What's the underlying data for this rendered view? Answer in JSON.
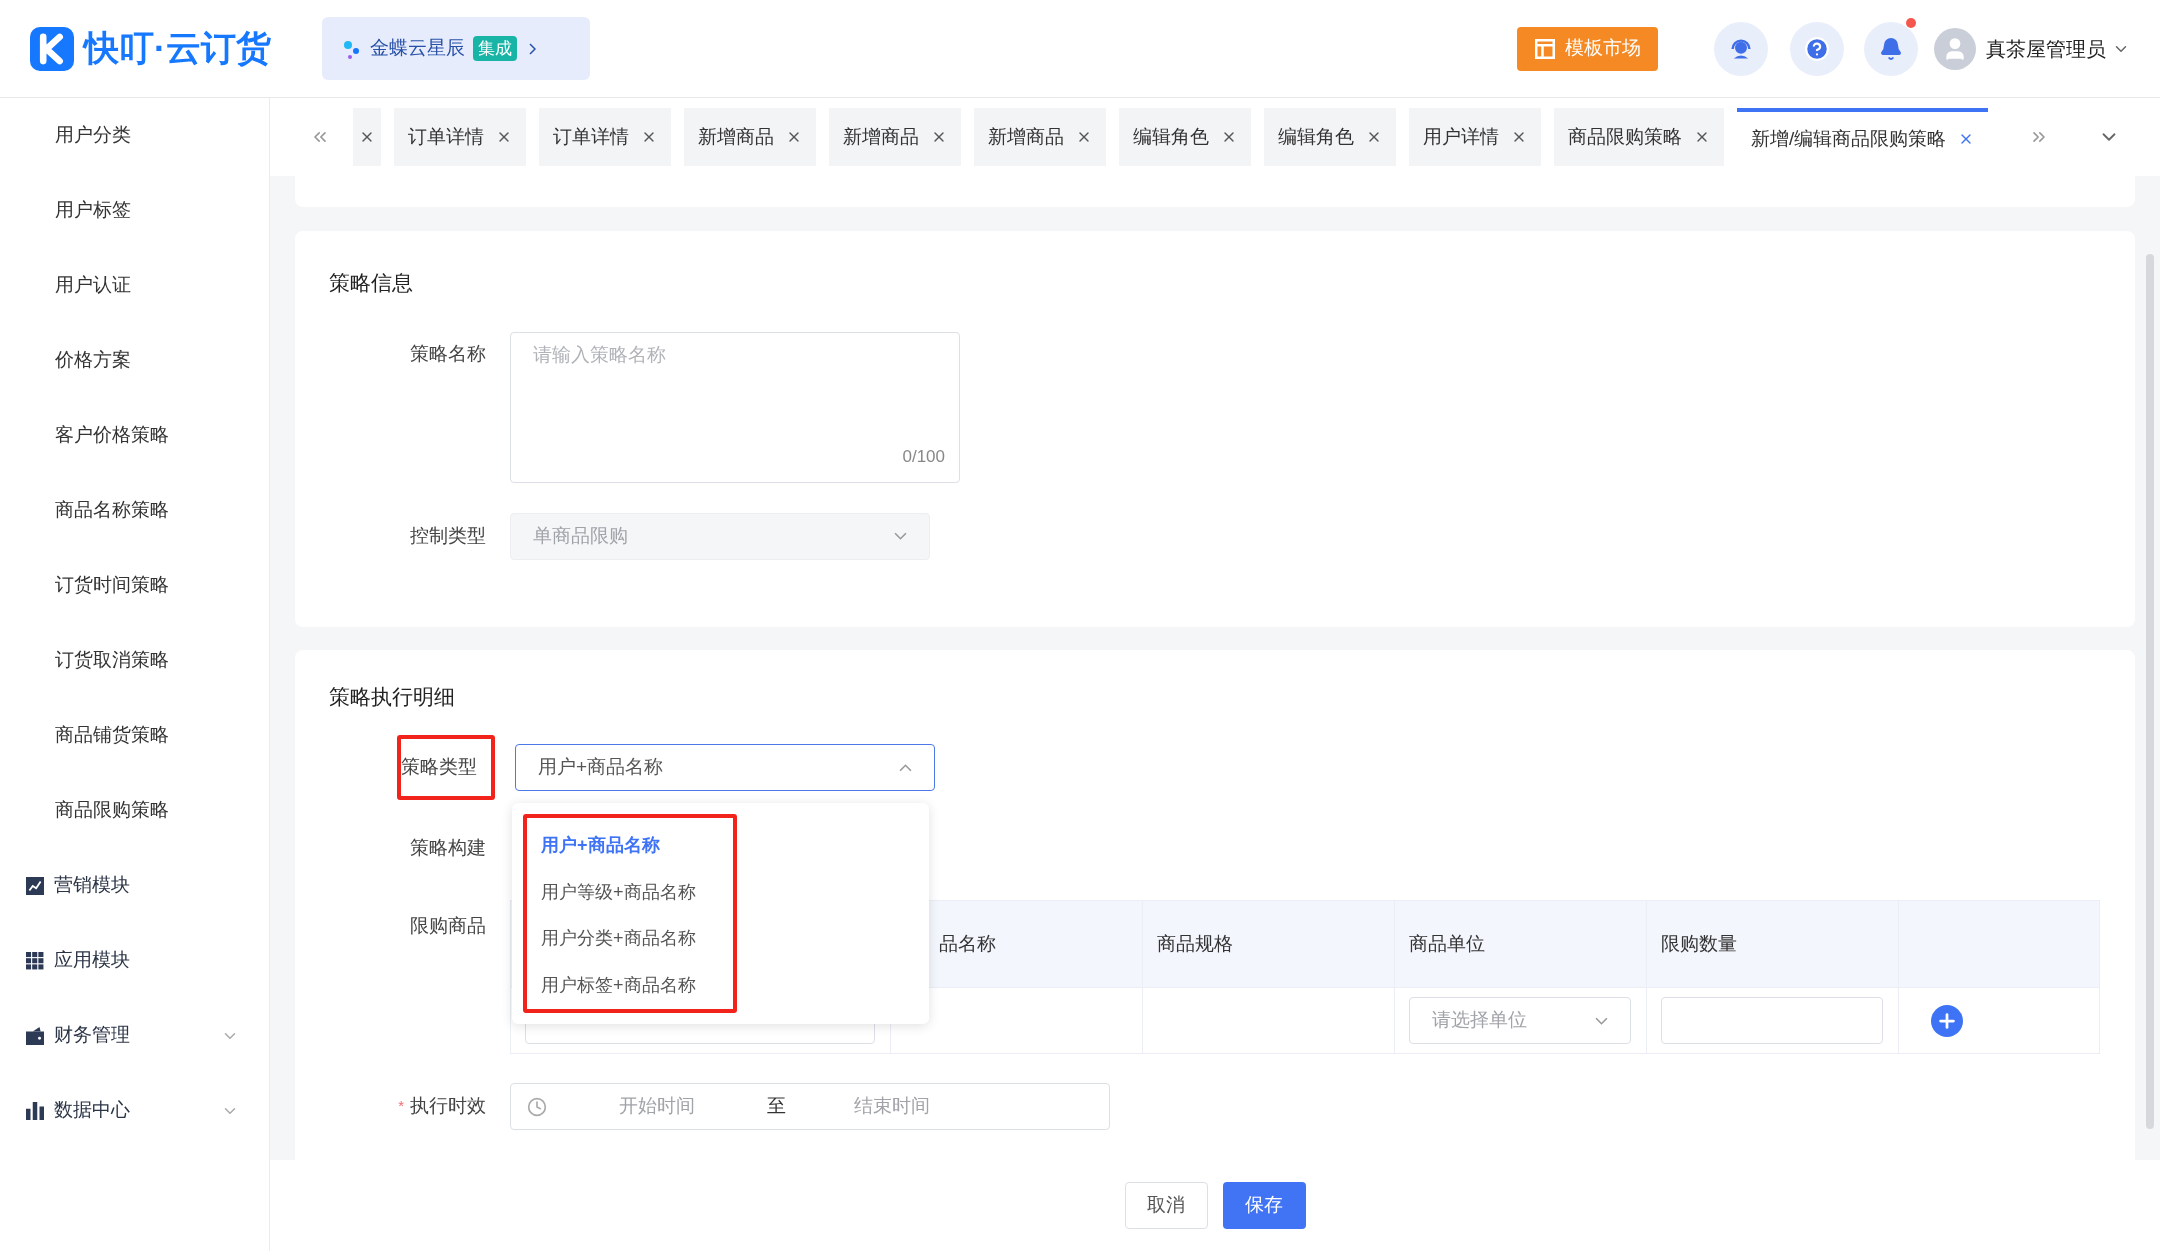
{
  "header": {
    "logo_text": "快叮·云订货",
    "banner": {
      "text": "金蝶云星辰",
      "badge": "集成"
    },
    "template_button": "模板市场",
    "notification_dot": true,
    "user_name": "真茶屋管理员"
  },
  "sidebar": {
    "items": [
      {
        "kind": "sub",
        "label": "用户分类"
      },
      {
        "kind": "sub",
        "label": "用户标签"
      },
      {
        "kind": "sub",
        "label": "用户认证"
      },
      {
        "kind": "sub",
        "label": "价格方案"
      },
      {
        "kind": "sub",
        "label": "客户价格策略"
      },
      {
        "kind": "sub",
        "label": "商品名称策略"
      },
      {
        "kind": "sub",
        "label": "订货时间策略"
      },
      {
        "kind": "sub",
        "label": "订货取消策略"
      },
      {
        "kind": "sub",
        "label": "商品铺货策略"
      },
      {
        "kind": "sub",
        "label": "商品限购策略"
      },
      {
        "kind": "module",
        "label": "营销模块"
      },
      {
        "kind": "module",
        "label": "应用模块"
      },
      {
        "kind": "group",
        "label": "财务管理",
        "expanded": false
      },
      {
        "kind": "group",
        "label": "数据中心",
        "expanded": false
      }
    ]
  },
  "tabs": [
    {
      "kind": "partial",
      "selected": false
    },
    {
      "kind": "tab",
      "label": "订单详情",
      "selected": false
    },
    {
      "kind": "tab",
      "label": "订单详情",
      "selected": false
    },
    {
      "kind": "tab",
      "label": "新增商品",
      "selected": false
    },
    {
      "kind": "tab",
      "label": "新增商品",
      "selected": false
    },
    {
      "kind": "tab",
      "label": "新增商品",
      "selected": false
    },
    {
      "kind": "tab",
      "label": "编辑角色",
      "selected": false
    },
    {
      "kind": "tab",
      "label": "编辑角色",
      "selected": false
    },
    {
      "kind": "tab",
      "label": "用户详情",
      "selected": false
    },
    {
      "kind": "tab",
      "label": "商品限购策略",
      "selected": false
    },
    {
      "kind": "tab",
      "label": "新增/编辑商品限购策略",
      "selected": true
    }
  ],
  "strategy_info": {
    "title": "策略信息",
    "name_label": "策略名称",
    "name_placeholder": "请输入策略名称",
    "name_counter": "0/100",
    "control_label": "控制类型",
    "control_value": "单商品限购",
    "control_disabled": true
  },
  "execution": {
    "title": "策略执行明细",
    "type_label": {
      "text": "策略类型",
      "highlighted": true
    },
    "type_value": "用户+商品名称",
    "dropdown_open": true,
    "options_highlighted": true,
    "options": [
      {
        "label": "用户+商品名称",
        "selected": true
      },
      {
        "label": "用户等级+商品名称",
        "selected": false
      },
      {
        "label": "用户分类+商品名称",
        "selected": false
      },
      {
        "label": "用户标签+商品名称",
        "selected": false
      }
    ],
    "build_label": "策略构建",
    "goods_label": "限购商品",
    "table": {
      "columns": [
        "品名称",
        "商品规格",
        "商品单位",
        "限购数量"
      ],
      "unit_placeholder": "请选择单位"
    },
    "time_label": "执行时效",
    "time_required": true,
    "required_mark": "*",
    "start_placeholder": "开始时间",
    "range_separator": "至",
    "end_placeholder": "结束时间"
  },
  "footer": {
    "cancel": "取消",
    "save": "保存"
  }
}
